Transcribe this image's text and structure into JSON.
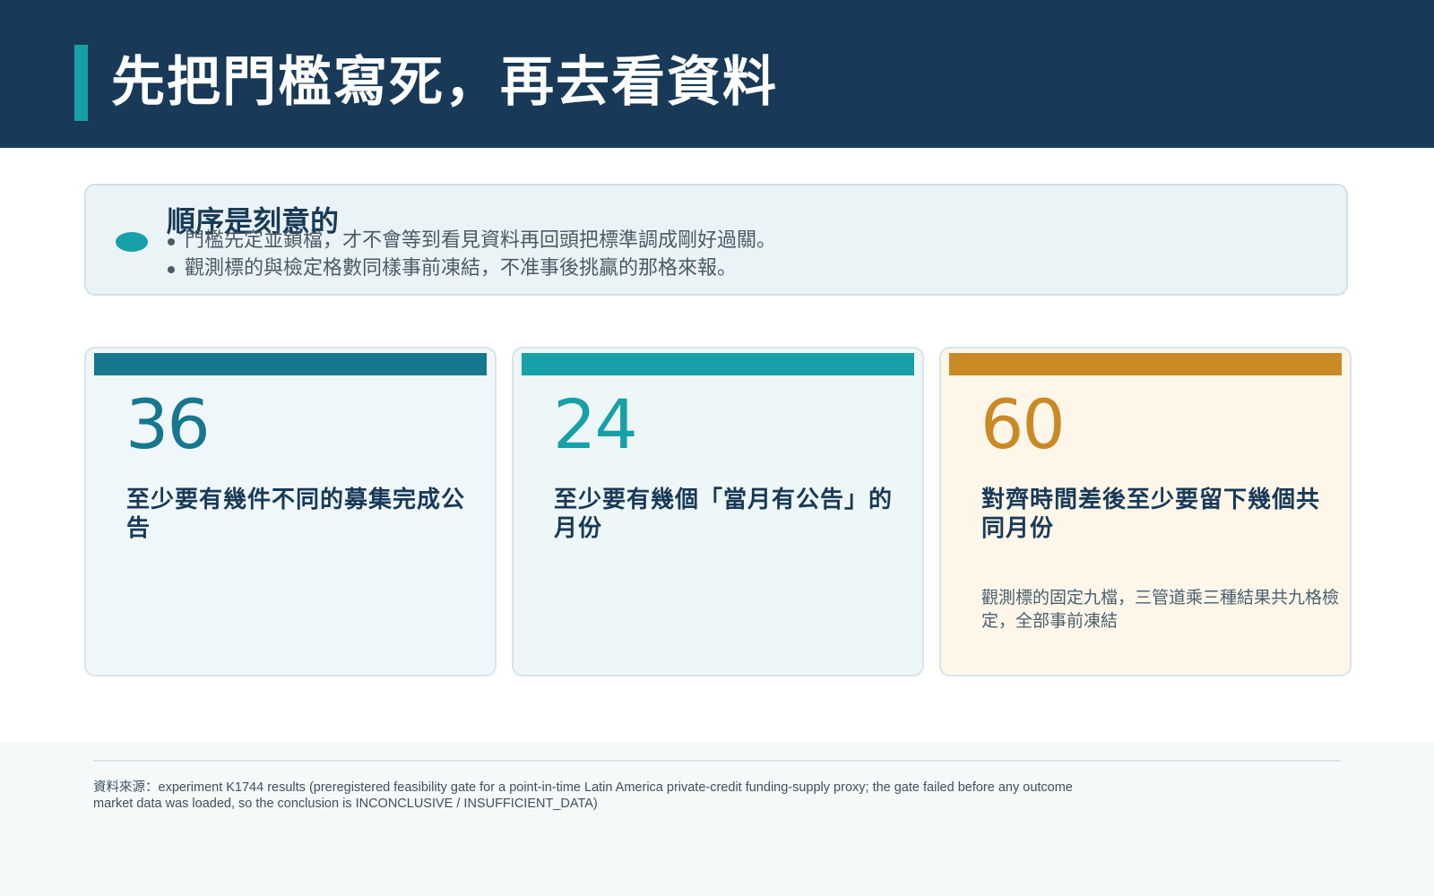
{
  "header": {
    "title": "先把門檻寫死，再去看資料"
  },
  "callout": {
    "title": "順序是刻意的",
    "bullets": [
      "門檻先定並鎖檔，才不會等到看見資料再回頭把標準調成剛好過關。",
      "觀測標的與檢定格數同樣事前凍結，不准事後挑贏的那格來報。"
    ]
  },
  "cards": [
    {
      "number": "36",
      "label": "至少要有幾件不同的募集完成公告",
      "note": "",
      "accent_color": "#16778f",
      "background_color": "#f0f7fa"
    },
    {
      "number": "24",
      "label": "至少要有幾個「當月有公告」的月份",
      "note": "",
      "accent_color": "#17a0a7",
      "background_color": "#eef7f7"
    },
    {
      "number": "60",
      "label": "對齊時間差後至少要留下幾個共同月份",
      "note": "觀測標的固定九檔，三管道乘三種結果共九格檢定，全部事前凍結",
      "accent_color": "#c98a26",
      "background_color": "#fef7e9"
    }
  ],
  "footer": {
    "source": "資料來源：experiment K1744 results (preregistered feasibility gate for a point-in-time Latin America private-credit funding-supply proxy; the gate failed before any outcome market data was loaded, so the conclusion is INCONCLUSIVE / INSUFFICIENT_DATA)"
  },
  "colors": {
    "header_bg": "#183a58",
    "teal": "#17a0a7",
    "dark_teal": "#16778f",
    "amber": "#c98a26",
    "text_dark": "#183a58",
    "text_muted": "#4a5a67"
  }
}
